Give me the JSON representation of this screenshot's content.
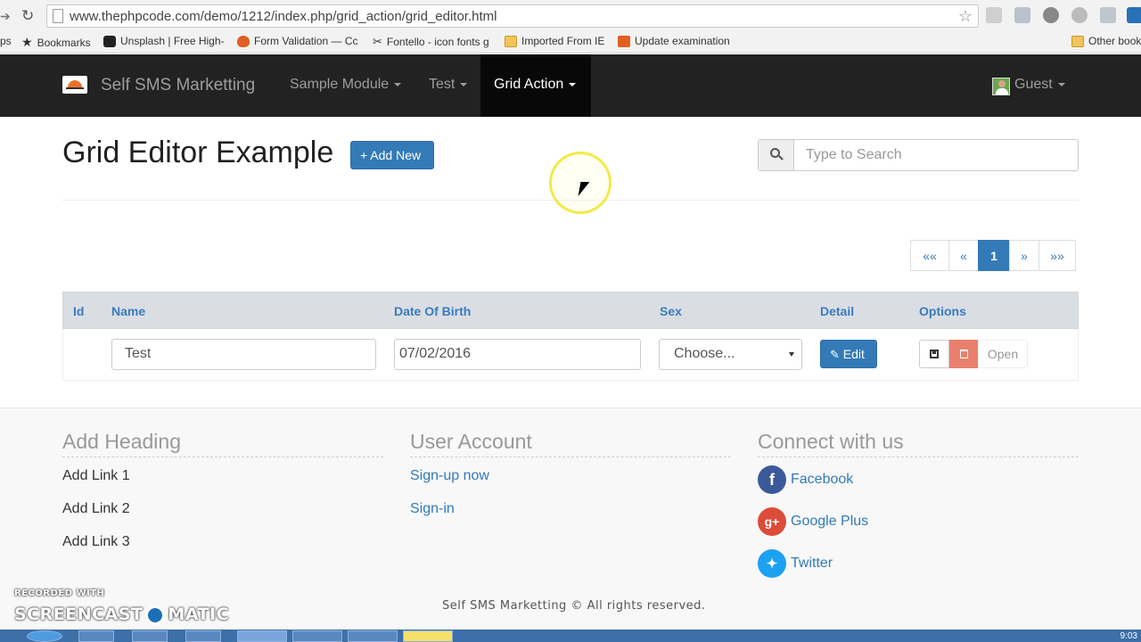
{
  "browser": {
    "url": "www.thephpcode.com/demo/1212/index.php/grid_action/grid_editor.html",
    "bookmarks": [
      {
        "label": "ps",
        "icon": "none"
      },
      {
        "label": "Bookmarks",
        "icon": "star-icon"
      },
      {
        "label": "Unsplash | Free High-",
        "icon": "camera-icon"
      },
      {
        "label": "Form Validation — Cc",
        "icon": "flame-icon"
      },
      {
        "label": "Fontello - icon fonts g",
        "icon": "scissors-icon"
      },
      {
        "label": "Imported From IE",
        "icon": "folder-icon"
      },
      {
        "label": "Update examination",
        "icon": "form-icon"
      },
      {
        "label": "Other book",
        "icon": "folder-icon"
      }
    ]
  },
  "navbar": {
    "brand": "Self SMS Marketting",
    "items": [
      "Sample Module",
      "Test",
      "Grid Action"
    ],
    "active": "Grid Action",
    "user": "Guest"
  },
  "header": {
    "title": "Grid Editor Example",
    "add_button": "+ Add New",
    "search_placeholder": "Type to Search"
  },
  "pagination": [
    "««",
    "«",
    "1",
    "»",
    "»»"
  ],
  "pagination_active": "1",
  "table": {
    "columns": [
      "Id",
      "Name",
      "Date Of Birth",
      "Sex",
      "Detail",
      "Options"
    ],
    "row": {
      "id": "",
      "name": "Test",
      "dob": "07/02/2016",
      "sex": "Choose...",
      "detail_button": "Edit",
      "open_button": "Open"
    }
  },
  "footer": {
    "col1": {
      "heading": "Add Heading",
      "links": [
        "Add Link 1",
        "Add Link 2",
        "Add Link 3"
      ]
    },
    "col2": {
      "heading": "User Account",
      "links": [
        "Sign-up now",
        "Sign-in"
      ]
    },
    "col3": {
      "heading": "Connect with us",
      "links": [
        "Facebook",
        "Google Plus",
        "Twitter"
      ]
    },
    "copyright": "Self SMS Marketting © All rights reserved."
  },
  "watermark": {
    "line1": "RECORDED WITH",
    "line2a": "SCREENCAST",
    "line2b": "MATIC"
  },
  "taskbar": {
    "clock": "9:03"
  },
  "colors": {
    "primary": "#337ab7",
    "navbar": "#222222",
    "danger": "#e9806e",
    "facebook": "#3b5998",
    "googleplus": "#dd4b39",
    "twitter": "#1da1f2"
  }
}
